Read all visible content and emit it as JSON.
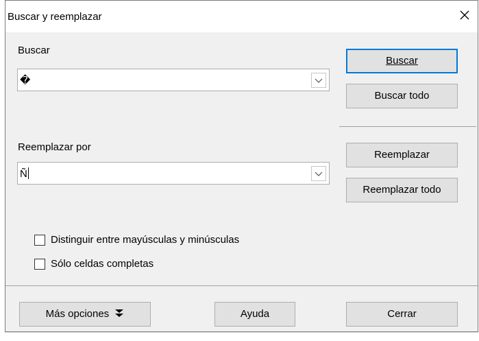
{
  "dialog": {
    "title": "Buscar y reemplazar"
  },
  "find": {
    "label": "Buscar",
    "value": "�"
  },
  "replace": {
    "label": "Reemplazar por",
    "value": "Ñ"
  },
  "buttons": {
    "find": "Buscar",
    "find_all": "Buscar todo",
    "replace": "Reemplazar",
    "replace_all": "Reemplazar todo",
    "more_options": "Más opciones",
    "help": "Ayuda",
    "close": "Cerrar"
  },
  "options": {
    "match_case": {
      "label": "Distinguir entre mayúsculas y minúsculas",
      "checked": false
    },
    "whole_cells": {
      "label": "Sólo celdas completas",
      "checked": false
    }
  },
  "icons": {
    "close": "close-icon",
    "dropdown": "chevron-down-icon",
    "more_options": "double-chevron-down-icon"
  },
  "colors": {
    "dialog_bg": "#f0f0f0",
    "default_button_border": "#0078d7",
    "button_bg": "#e1e1e1"
  }
}
